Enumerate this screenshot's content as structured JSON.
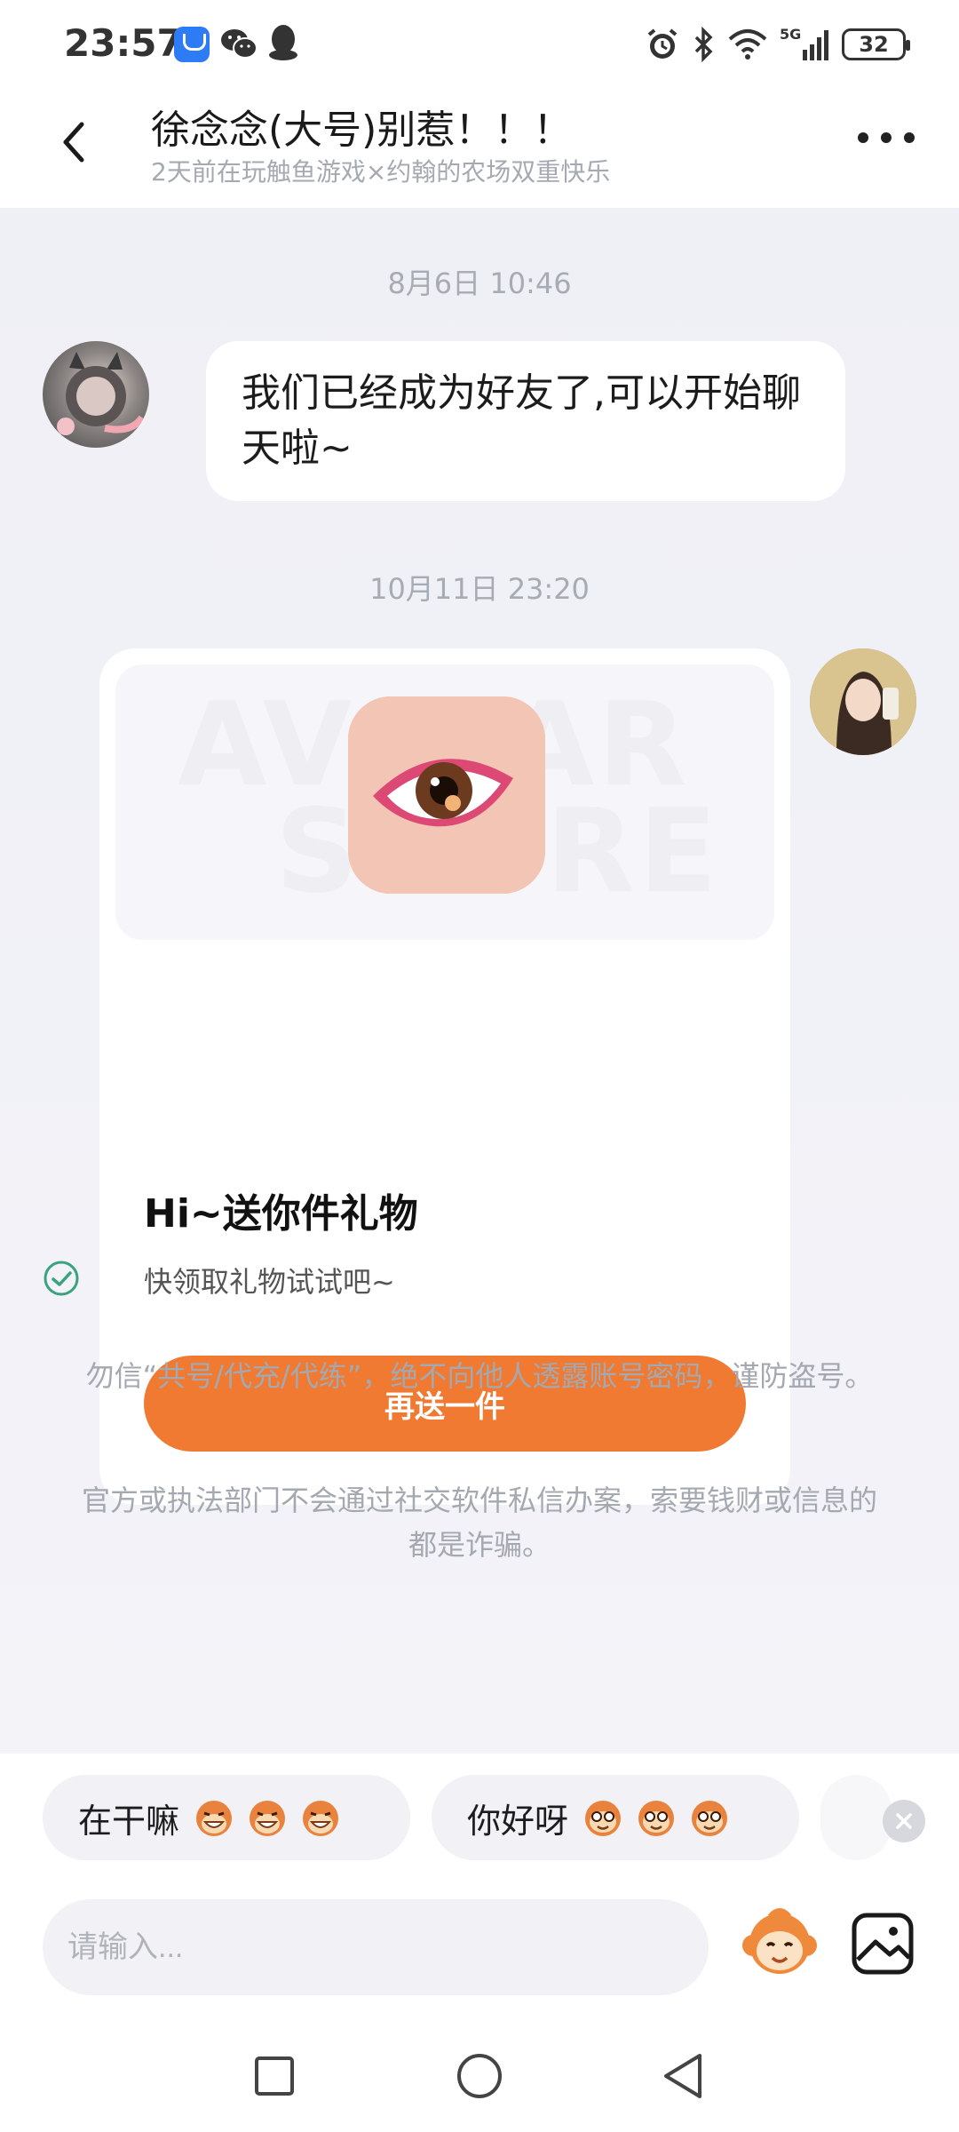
{
  "status_bar": {
    "time": "23:57",
    "battery": "32",
    "network": "5G",
    "icons": [
      "honor-app-icon",
      "wechat-icon",
      "qq-icon",
      "alarm-icon",
      "bluetooth-icon",
      "wifi-icon",
      "signal-icon",
      "battery-icon"
    ]
  },
  "header": {
    "title": "徐念念(大号)别惹！！！",
    "subtitle": "2天前在玩触鱼游戏×约翰的农场双重快乐",
    "back_icon": "chevron-left-icon",
    "more_icon": "more-dots-icon"
  },
  "messages": {
    "timestamp_1": "8月6日 10:46",
    "friend_message": "我们已经成为好友了,可以开始聊天啦~",
    "timestamp_2": "10月11日 23:20",
    "gift_card": {
      "banner_watermark_1": "AVATAR",
      "banner_watermark_2": "STORE",
      "title": "Hi~送你件礼物",
      "description": "快领取礼物试试吧~",
      "button_label": "再送一件"
    }
  },
  "notices": {
    "notice_1": "勿信“共号/代充/代练”，绝不向他人透露账号密码，谨防盗号。",
    "notice_2": "官方或执法部门不会通过社交软件私信办案，索要钱财或信息的都是诈骗。"
  },
  "quick_replies": {
    "items": [
      {
        "label": "在干嘛",
        "emoji": "grinning-monkey-emoji"
      },
      {
        "label": "你好呀",
        "emoji": "smiling-monkey-emoji"
      }
    ]
  },
  "input": {
    "placeholder": "请输入..."
  },
  "colors": {
    "accent": "#f07a31",
    "background": "#f3f4f8",
    "check": "#3aa37d"
  }
}
